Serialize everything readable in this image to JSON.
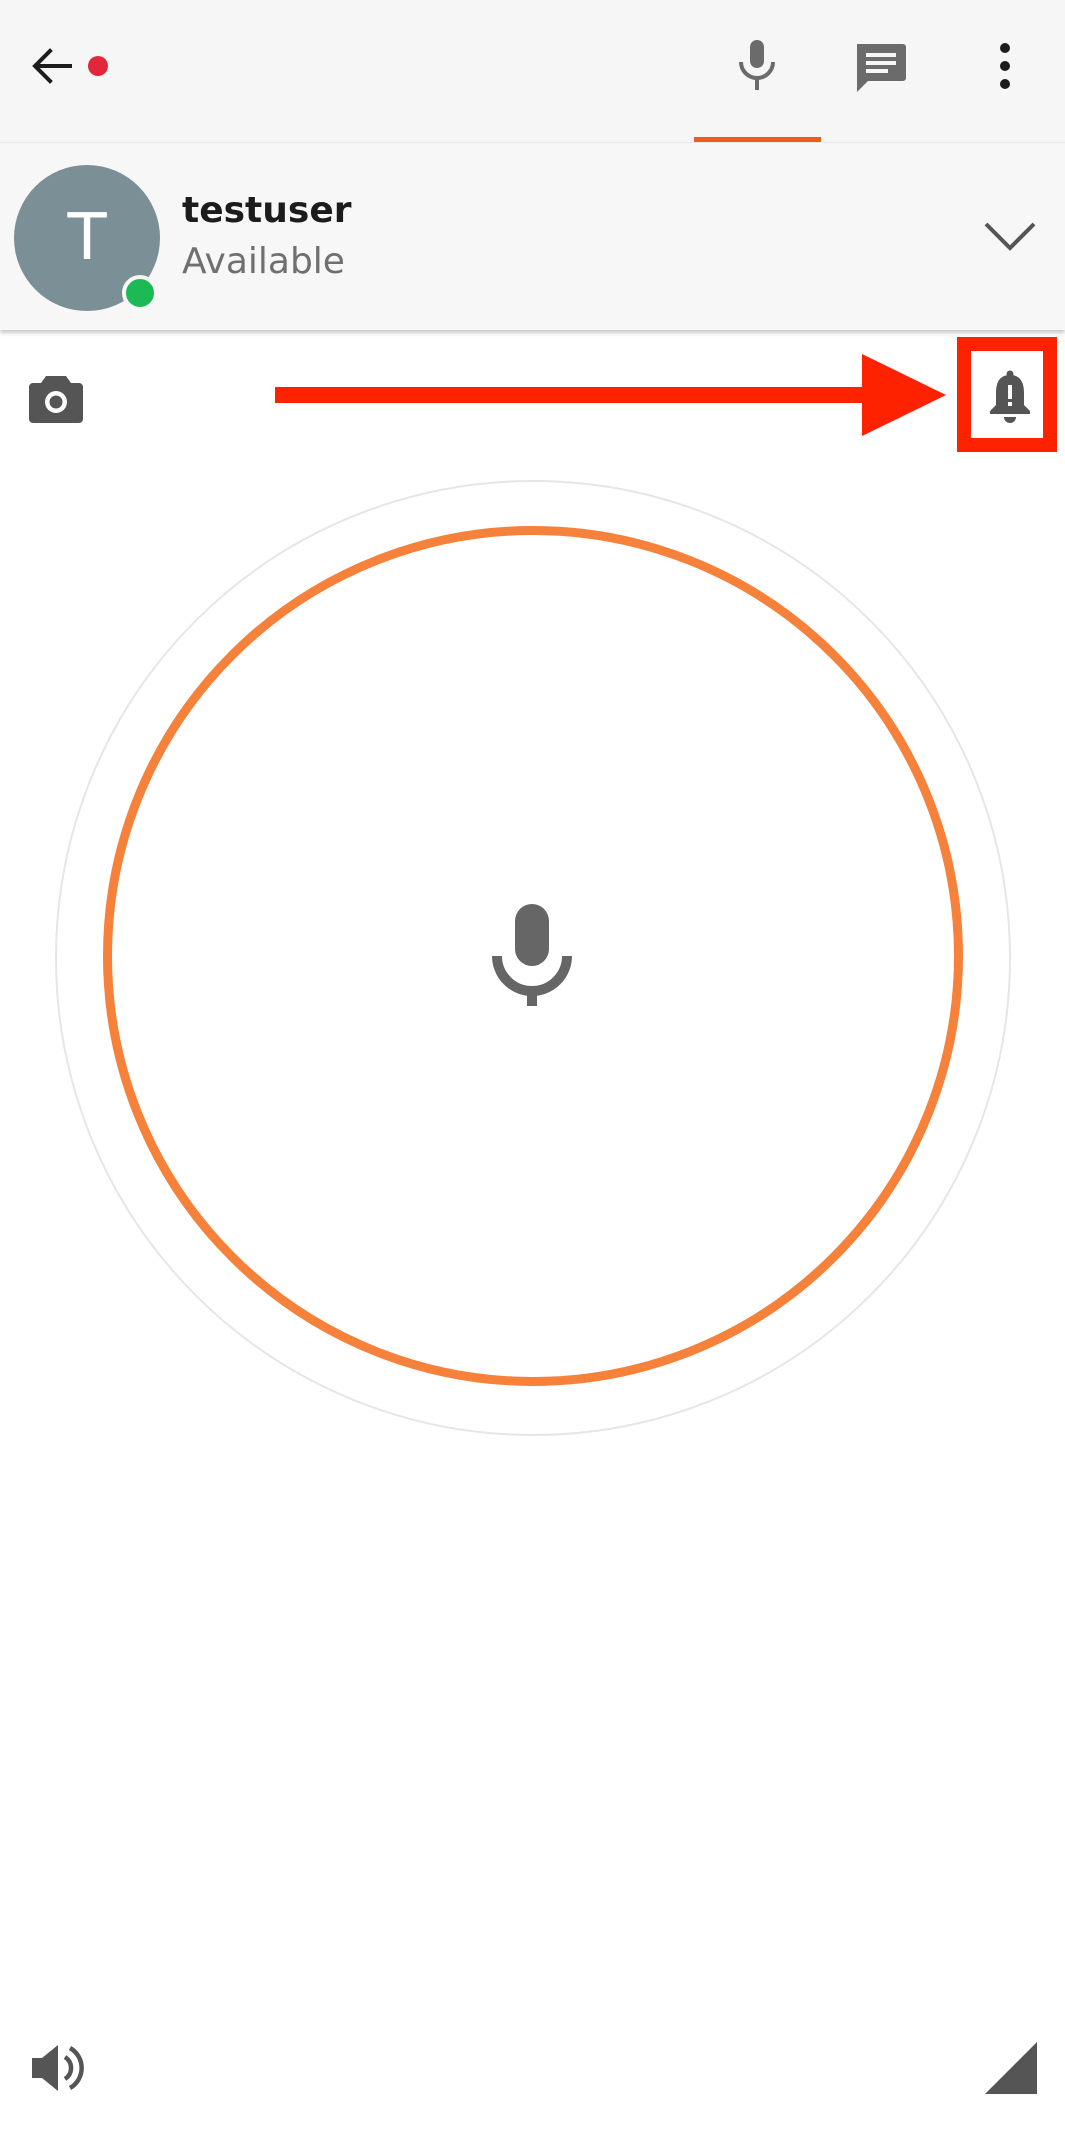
{
  "header": {
    "back_icon": "arrow-left-icon",
    "notification_dot_color": "#e0283a",
    "tabs": [
      {
        "icon": "microphone-icon",
        "selected": true
      },
      {
        "icon": "chat-message-icon",
        "selected": false
      }
    ],
    "menu_icon": "more-vertical-icon",
    "accent_color": "#f05a1f"
  },
  "contact": {
    "avatar_initial": "T",
    "avatar_color": "#7a8f96",
    "name": "testuser",
    "status": "Available",
    "presence_color": "#1db954",
    "expand_icon": "chevron-down-icon"
  },
  "toolbar": {
    "camera_icon": "camera-icon",
    "alert_icon": "bell-alert-icon"
  },
  "annotation": {
    "arrow_color": "#ff2200",
    "highlight_target": "bell-alert-icon"
  },
  "talk": {
    "ring_color": "#f5813a",
    "mic_icon": "microphone-icon"
  },
  "footer": {
    "speaker_icon": "speaker-volume-icon",
    "corner_icon": "signal-triangle-icon"
  }
}
